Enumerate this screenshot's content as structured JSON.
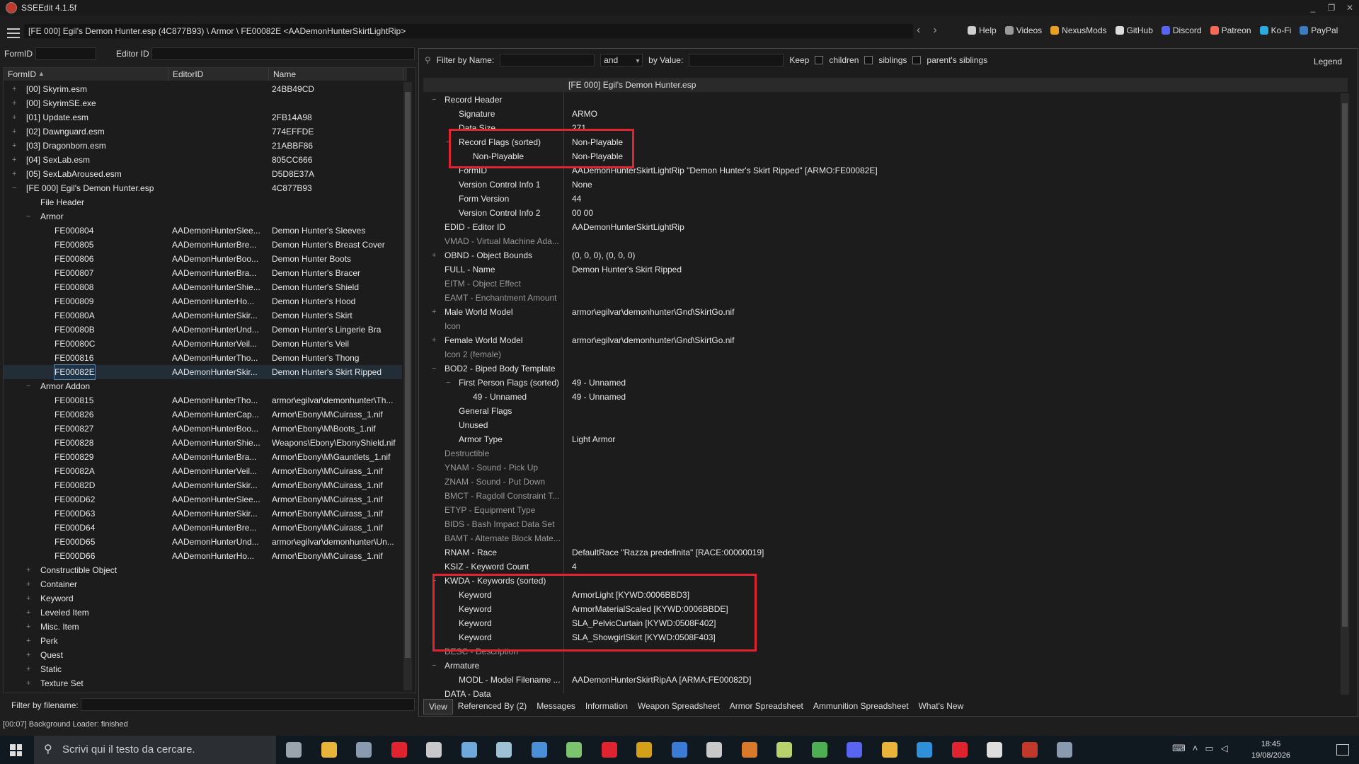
{
  "window": {
    "title": "SSEEdit 4.1.5f",
    "controls": [
      "_",
      "❐",
      "✕"
    ]
  },
  "toolbar": {
    "path": "[FE 000] Egil's Demon Hunter.esp (4C877B93) \\ Armor \\ FE00082E <AADemonHunterSkirtLightRip>",
    "nav_back": "‹",
    "nav_forward": "›",
    "links": [
      {
        "label": "Help",
        "icon": "book-icon",
        "color": "#cfcfcf"
      },
      {
        "label": "Videos",
        "icon": "video-icon",
        "color": "#9a9a9a"
      },
      {
        "label": "NexusMods",
        "icon": "nexus-icon",
        "color": "#e8a020"
      },
      {
        "label": "GitHub",
        "icon": "github-icon",
        "color": "#dddddd"
      },
      {
        "label": "Discord",
        "icon": "discord-icon",
        "color": "#5865f2"
      },
      {
        "label": "Patreon",
        "icon": "patreon-icon",
        "color": "#f96854"
      },
      {
        "label": "Ko-Fi",
        "icon": "kofi-icon",
        "color": "#29abe0"
      },
      {
        "label": "PayPal",
        "icon": "paypal-icon",
        "color": "#3b7bbf"
      }
    ]
  },
  "left": {
    "formid_label": "FormID",
    "editorid_label": "Editor ID",
    "columns": [
      "FormID",
      "EditorID",
      "Name"
    ],
    "filter_label": "Filter by filename:",
    "rows": [
      {
        "indent": 0,
        "exp": "+",
        "c1": "[00] Skyrim.esm",
        "c2": "",
        "c3": "24BB49CD"
      },
      {
        "indent": 0,
        "exp": "+",
        "c1": "[00] SkyrimSE.exe",
        "c2": "",
        "c3": ""
      },
      {
        "indent": 0,
        "exp": "+",
        "c1": "[01] Update.esm",
        "c2": "",
        "c3": "2FB14A98"
      },
      {
        "indent": 0,
        "exp": "+",
        "c1": "[02] Dawnguard.esm",
        "c2": "",
        "c3": "774EFFDE"
      },
      {
        "indent": 0,
        "exp": "+",
        "c1": "[03] Dragonborn.esm",
        "c2": "",
        "c3": "21ABBF86"
      },
      {
        "indent": 0,
        "exp": "+",
        "c1": "[04] SexLab.esm",
        "c2": "",
        "c3": "805CC666"
      },
      {
        "indent": 0,
        "exp": "+",
        "c1": "[05] SexLabAroused.esm",
        "c2": "",
        "c3": "D5D8E37A"
      },
      {
        "indent": 0,
        "exp": "−",
        "c1": "[FE 000] Egil's Demon Hunter.esp",
        "c2": "",
        "c3": "4C877B93"
      },
      {
        "indent": 1,
        "exp": "",
        "c1": "File Header",
        "c2": "",
        "c3": ""
      },
      {
        "indent": 1,
        "exp": "−",
        "c1": "Armor",
        "c2": "",
        "c3": ""
      },
      {
        "indent": 2,
        "exp": "",
        "c1": "FE000804",
        "c2": "AADemonHunterSlee...",
        "c3": "Demon Hunter's Sleeves"
      },
      {
        "indent": 2,
        "exp": "",
        "c1": "FE000805",
        "c2": "AADemonHunterBre...",
        "c3": "Demon Hunter's Breast Cover"
      },
      {
        "indent": 2,
        "exp": "",
        "c1": "FE000806",
        "c2": "AADemonHunterBoo...",
        "c3": "Demon Hunter Boots"
      },
      {
        "indent": 2,
        "exp": "",
        "c1": "FE000807",
        "c2": "AADemonHunterBra...",
        "c3": "Demon Hunter's Bracer"
      },
      {
        "indent": 2,
        "exp": "",
        "c1": "FE000808",
        "c2": "AADemonHunterShie...",
        "c3": "Demon Hunter's Shield"
      },
      {
        "indent": 2,
        "exp": "",
        "c1": "FE000809",
        "c2": "AADemonHunterHo...",
        "c3": "Demon Hunter's Hood"
      },
      {
        "indent": 2,
        "exp": "",
        "c1": "FE00080A",
        "c2": "AADemonHunterSkir...",
        "c3": "Demon Hunter's Skirt"
      },
      {
        "indent": 2,
        "exp": "",
        "c1": "FE00080B",
        "c2": "AADemonHunterUnd...",
        "c3": "Demon Hunter's Lingerie Bra"
      },
      {
        "indent": 2,
        "exp": "",
        "c1": "FE00080C",
        "c2": "AADemonHunterVeil...",
        "c3": "Demon Hunter's Veil"
      },
      {
        "indent": 2,
        "exp": "",
        "c1": "FE000816",
        "c2": "AADemonHunterTho...",
        "c3": "Demon Hunter's Thong"
      },
      {
        "indent": 2,
        "exp": "",
        "c1": "FE00082E",
        "c2": "AADemonHunterSkir...",
        "c3": "Demon Hunter's Skirt Ripped",
        "sel": true
      },
      {
        "indent": 1,
        "exp": "−",
        "c1": "Armor Addon",
        "c2": "",
        "c3": ""
      },
      {
        "indent": 2,
        "exp": "",
        "c1": "FE000815",
        "c2": "AADemonHunterTho...",
        "c3": "armor\\egilvar\\demonhunter\\Th..."
      },
      {
        "indent": 2,
        "exp": "",
        "c1": "FE000826",
        "c2": "AADemonHunterCap...",
        "c3": "Armor\\Ebony\\M\\Cuirass_1.nif"
      },
      {
        "indent": 2,
        "exp": "",
        "c1": "FE000827",
        "c2": "AADemonHunterBoo...",
        "c3": "Armor\\Ebony\\M\\Boots_1.nif"
      },
      {
        "indent": 2,
        "exp": "",
        "c1": "FE000828",
        "c2": "AADemonHunterShie...",
        "c3": "Weapons\\Ebony\\EbonyShield.nif"
      },
      {
        "indent": 2,
        "exp": "",
        "c1": "FE000829",
        "c2": "AADemonHunterBra...",
        "c3": "Armor\\Ebony\\M\\Gauntlets_1.nif"
      },
      {
        "indent": 2,
        "exp": "",
        "c1": "FE00082A",
        "c2": "AADemonHunterVeil...",
        "c3": "Armor\\Ebony\\M\\Cuirass_1.nif"
      },
      {
        "indent": 2,
        "exp": "",
        "c1": "FE00082D",
        "c2": "AADemonHunterSkir...",
        "c3": "Armor\\Ebony\\M\\Cuirass_1.nif"
      },
      {
        "indent": 2,
        "exp": "",
        "c1": "FE000D62",
        "c2": "AADemonHunterSlee...",
        "c3": "Armor\\Ebony\\M\\Cuirass_1.nif"
      },
      {
        "indent": 2,
        "exp": "",
        "c1": "FE000D63",
        "c2": "AADemonHunterSkir...",
        "c3": "Armor\\Ebony\\M\\Cuirass_1.nif"
      },
      {
        "indent": 2,
        "exp": "",
        "c1": "FE000D64",
        "c2": "AADemonHunterBre...",
        "c3": "Armor\\Ebony\\M\\Cuirass_1.nif"
      },
      {
        "indent": 2,
        "exp": "",
        "c1": "FE000D65",
        "c2": "AADemonHunterUnd...",
        "c3": "armor\\egilvar\\demonhunter\\Un..."
      },
      {
        "indent": 2,
        "exp": "",
        "c1": "FE000D66",
        "c2": "AADemonHunterHo...",
        "c3": "Armor\\Ebony\\M\\Cuirass_1.nif"
      },
      {
        "indent": 1,
        "exp": "+",
        "c1": "Constructible Object",
        "c2": "",
        "c3": ""
      },
      {
        "indent": 1,
        "exp": "+",
        "c1": "Container",
        "c2": "",
        "c3": ""
      },
      {
        "indent": 1,
        "exp": "+",
        "c1": "Keyword",
        "c2": "",
        "c3": ""
      },
      {
        "indent": 1,
        "exp": "+",
        "c1": "Leveled Item",
        "c2": "",
        "c3": ""
      },
      {
        "indent": 1,
        "exp": "+",
        "c1": "Misc. Item",
        "c2": "",
        "c3": ""
      },
      {
        "indent": 1,
        "exp": "+",
        "c1": "Perk",
        "c2": "",
        "c3": ""
      },
      {
        "indent": 1,
        "exp": "+",
        "c1": "Quest",
        "c2": "",
        "c3": ""
      },
      {
        "indent": 1,
        "exp": "+",
        "c1": "Static",
        "c2": "",
        "c3": ""
      },
      {
        "indent": 1,
        "exp": "+",
        "c1": "Texture Set",
        "c2": "",
        "c3": ""
      }
    ]
  },
  "right": {
    "filter_name_label": "Filter by Name:",
    "and_value": "and",
    "by_value_label": "by Value:",
    "keep_label": "Keep",
    "children_label": "children",
    "siblings_label": "siblings",
    "parents_siblings_label": "parent's siblings",
    "legend_label": "Legend",
    "header_file": "[FE 000] Egil's Demon Hunter.esp",
    "rows": [
      {
        "indent": 0,
        "exp": "−",
        "n": "Record Header",
        "v": ""
      },
      {
        "indent": 1,
        "exp": "",
        "n": "Signature",
        "v": "ARMO"
      },
      {
        "indent": 1,
        "exp": "",
        "n": "Data Size",
        "v": "271"
      },
      {
        "indent": 1,
        "exp": "−",
        "n": "Record Flags (sorted)",
        "v": "Non-Playable"
      },
      {
        "indent": 2,
        "exp": "",
        "n": "Non-Playable",
        "v": "Non-Playable"
      },
      {
        "indent": 1,
        "exp": "",
        "n": "FormID",
        "v": "AADemonHunterSkirtLightRip \"Demon Hunter's Skirt Ripped\" [ARMO:FE00082E]"
      },
      {
        "indent": 1,
        "exp": "",
        "n": "Version Control Info 1",
        "v": "None"
      },
      {
        "indent": 1,
        "exp": "",
        "n": "Form Version",
        "v": "44"
      },
      {
        "indent": 1,
        "exp": "",
        "n": "Version Control Info 2",
        "v": "00 00"
      },
      {
        "indent": 0,
        "exp": "",
        "n": "EDID - Editor ID",
        "v": "AADemonHunterSkirtLightRip"
      },
      {
        "indent": 0,
        "exp": "",
        "n": "VMAD - Virtual Machine Ada...",
        "v": "",
        "grey": true
      },
      {
        "indent": 0,
        "exp": "+",
        "n": "OBND - Object Bounds",
        "v": "(0, 0, 0), (0, 0, 0)"
      },
      {
        "indent": 0,
        "exp": "",
        "n": "FULL - Name",
        "v": "Demon Hunter's Skirt Ripped"
      },
      {
        "indent": 0,
        "exp": "",
        "n": "EITM - Object Effect",
        "v": "",
        "grey": true
      },
      {
        "indent": 0,
        "exp": "",
        "n": "EAMT - Enchantment Amount",
        "v": "",
        "grey": true
      },
      {
        "indent": 0,
        "exp": "+",
        "n": "Male World Model",
        "v": "armor\\egilvar\\demonhunter\\Gnd\\SkirtGo.nif"
      },
      {
        "indent": 0,
        "exp": "",
        "n": "Icon",
        "v": "",
        "grey": true
      },
      {
        "indent": 0,
        "exp": "+",
        "n": "Female World Model",
        "v": "armor\\egilvar\\demonhunter\\Gnd\\SkirtGo.nif"
      },
      {
        "indent": 0,
        "exp": "",
        "n": "Icon 2 (female)",
        "v": "",
        "grey": true
      },
      {
        "indent": 0,
        "exp": "−",
        "n": "BOD2 - Biped Body Template",
        "v": ""
      },
      {
        "indent": 1,
        "exp": "−",
        "n": "First Person Flags (sorted)",
        "v": "49 - Unnamed"
      },
      {
        "indent": 2,
        "exp": "",
        "n": "49 - Unnamed",
        "v": "49 - Unnamed"
      },
      {
        "indent": 1,
        "exp": "",
        "n": "General Flags",
        "v": ""
      },
      {
        "indent": 1,
        "exp": "",
        "n": "Unused",
        "v": ""
      },
      {
        "indent": 1,
        "exp": "",
        "n": "Armor Type",
        "v": "Light Armor"
      },
      {
        "indent": 0,
        "exp": "",
        "n": "Destructible",
        "v": "",
        "grey": true
      },
      {
        "indent": 0,
        "exp": "",
        "n": "YNAM - Sound - Pick Up",
        "v": "",
        "grey": true
      },
      {
        "indent": 0,
        "exp": "",
        "n": "ZNAM - Sound - Put Down",
        "v": "",
        "grey": true
      },
      {
        "indent": 0,
        "exp": "",
        "n": "BMCT - Ragdoll Constraint T...",
        "v": "",
        "grey": true
      },
      {
        "indent": 0,
        "exp": "",
        "n": "ETYP - Equipment Type",
        "v": "",
        "grey": true
      },
      {
        "indent": 0,
        "exp": "",
        "n": "BIDS - Bash Impact Data Set",
        "v": "",
        "grey": true
      },
      {
        "indent": 0,
        "exp": "",
        "n": "BAMT - Alternate Block Mate...",
        "v": "",
        "grey": true
      },
      {
        "indent": 0,
        "exp": "",
        "n": "RNAM - Race",
        "v": "DefaultRace \"Razza predefinita\" [RACE:00000019]"
      },
      {
        "indent": 0,
        "exp": "",
        "n": "KSIZ - Keyword Count",
        "v": "4"
      },
      {
        "indent": 0,
        "exp": "−",
        "n": "KWDA - Keywords (sorted)",
        "v": ""
      },
      {
        "indent": 1,
        "exp": "",
        "n": "Keyword",
        "v": "ArmorLight [KYWD:0006BBD3]"
      },
      {
        "indent": 1,
        "exp": "",
        "n": "Keyword",
        "v": "ArmorMaterialScaled [KYWD:0006BBDE]"
      },
      {
        "indent": 1,
        "exp": "",
        "n": "Keyword",
        "v": "SLA_PelvicCurtain [KYWD:0508F402]"
      },
      {
        "indent": 1,
        "exp": "",
        "n": "Keyword",
        "v": "SLA_ShowgirlSkirt [KYWD:0508F403]"
      },
      {
        "indent": 0,
        "exp": "",
        "n": "DESC - Description",
        "v": "",
        "grey": true
      },
      {
        "indent": 0,
        "exp": "−",
        "n": "Armature",
        "v": ""
      },
      {
        "indent": 1,
        "exp": "",
        "n": "MODL - Model Filename ...",
        "v": "AADemonHunterSkirtRipAA [ARMA:FE00082D]"
      },
      {
        "indent": 0,
        "exp": "",
        "n": "DATA - Data",
        "v": ""
      }
    ],
    "tabs": [
      "View",
      "Referenced By (2)",
      "Messages",
      "Information",
      "Weapon Spreadsheet",
      "Armor Spreadsheet",
      "Ammunition Spreadsheet",
      "What's New"
    ]
  },
  "status": "[00:07] Background Loader: finished",
  "taskbar": {
    "search_placeholder": "Scrivi qui il testo da cercare.",
    "time": "18:45",
    "date": "19/08/2026",
    "apps": [
      {
        "name": "task-view-icon",
        "color": "#9aa4ad"
      },
      {
        "name": "file-explorer-icon",
        "color": "#e8b53a"
      },
      {
        "name": "app-icon-1",
        "color": "#8a9bb0"
      },
      {
        "name": "opera-icon",
        "color": "#e0242f"
      },
      {
        "name": "msi-icon",
        "color": "#c9c9c9"
      },
      {
        "name": "app-icon-2",
        "color": "#6fa8dc"
      },
      {
        "name": "app-icon-3",
        "color": "#9ec1d6"
      },
      {
        "name": "app-icon-4",
        "color": "#4a90d9"
      },
      {
        "name": "notepad-icon",
        "color": "#7cc36e"
      },
      {
        "name": "app-icon-5",
        "color": "#e0242f"
      },
      {
        "name": "app-icon-6",
        "color": "#d4a017"
      },
      {
        "name": "app-icon-7",
        "color": "#3a7bd5"
      },
      {
        "name": "app-icon-8",
        "color": "#c9c9c9"
      },
      {
        "name": "app-icon-9",
        "color": "#d97a2b"
      },
      {
        "name": "app-icon-10",
        "color": "#b9d36c"
      },
      {
        "name": "chrome-icon",
        "color": "#4caf50"
      },
      {
        "name": "discord-icon",
        "color": "#5865f2"
      },
      {
        "name": "app-icon-11",
        "color": "#e8b53a"
      },
      {
        "name": "app-icon-12",
        "color": "#2f8fd8"
      },
      {
        "name": "app-icon-13",
        "color": "#e0242f"
      },
      {
        "name": "app-icon-14",
        "color": "#dddddd"
      },
      {
        "name": "sseedit-icon",
        "color": "#c0392b"
      },
      {
        "name": "app-icon-15",
        "color": "#8a9bb0"
      }
    ]
  }
}
